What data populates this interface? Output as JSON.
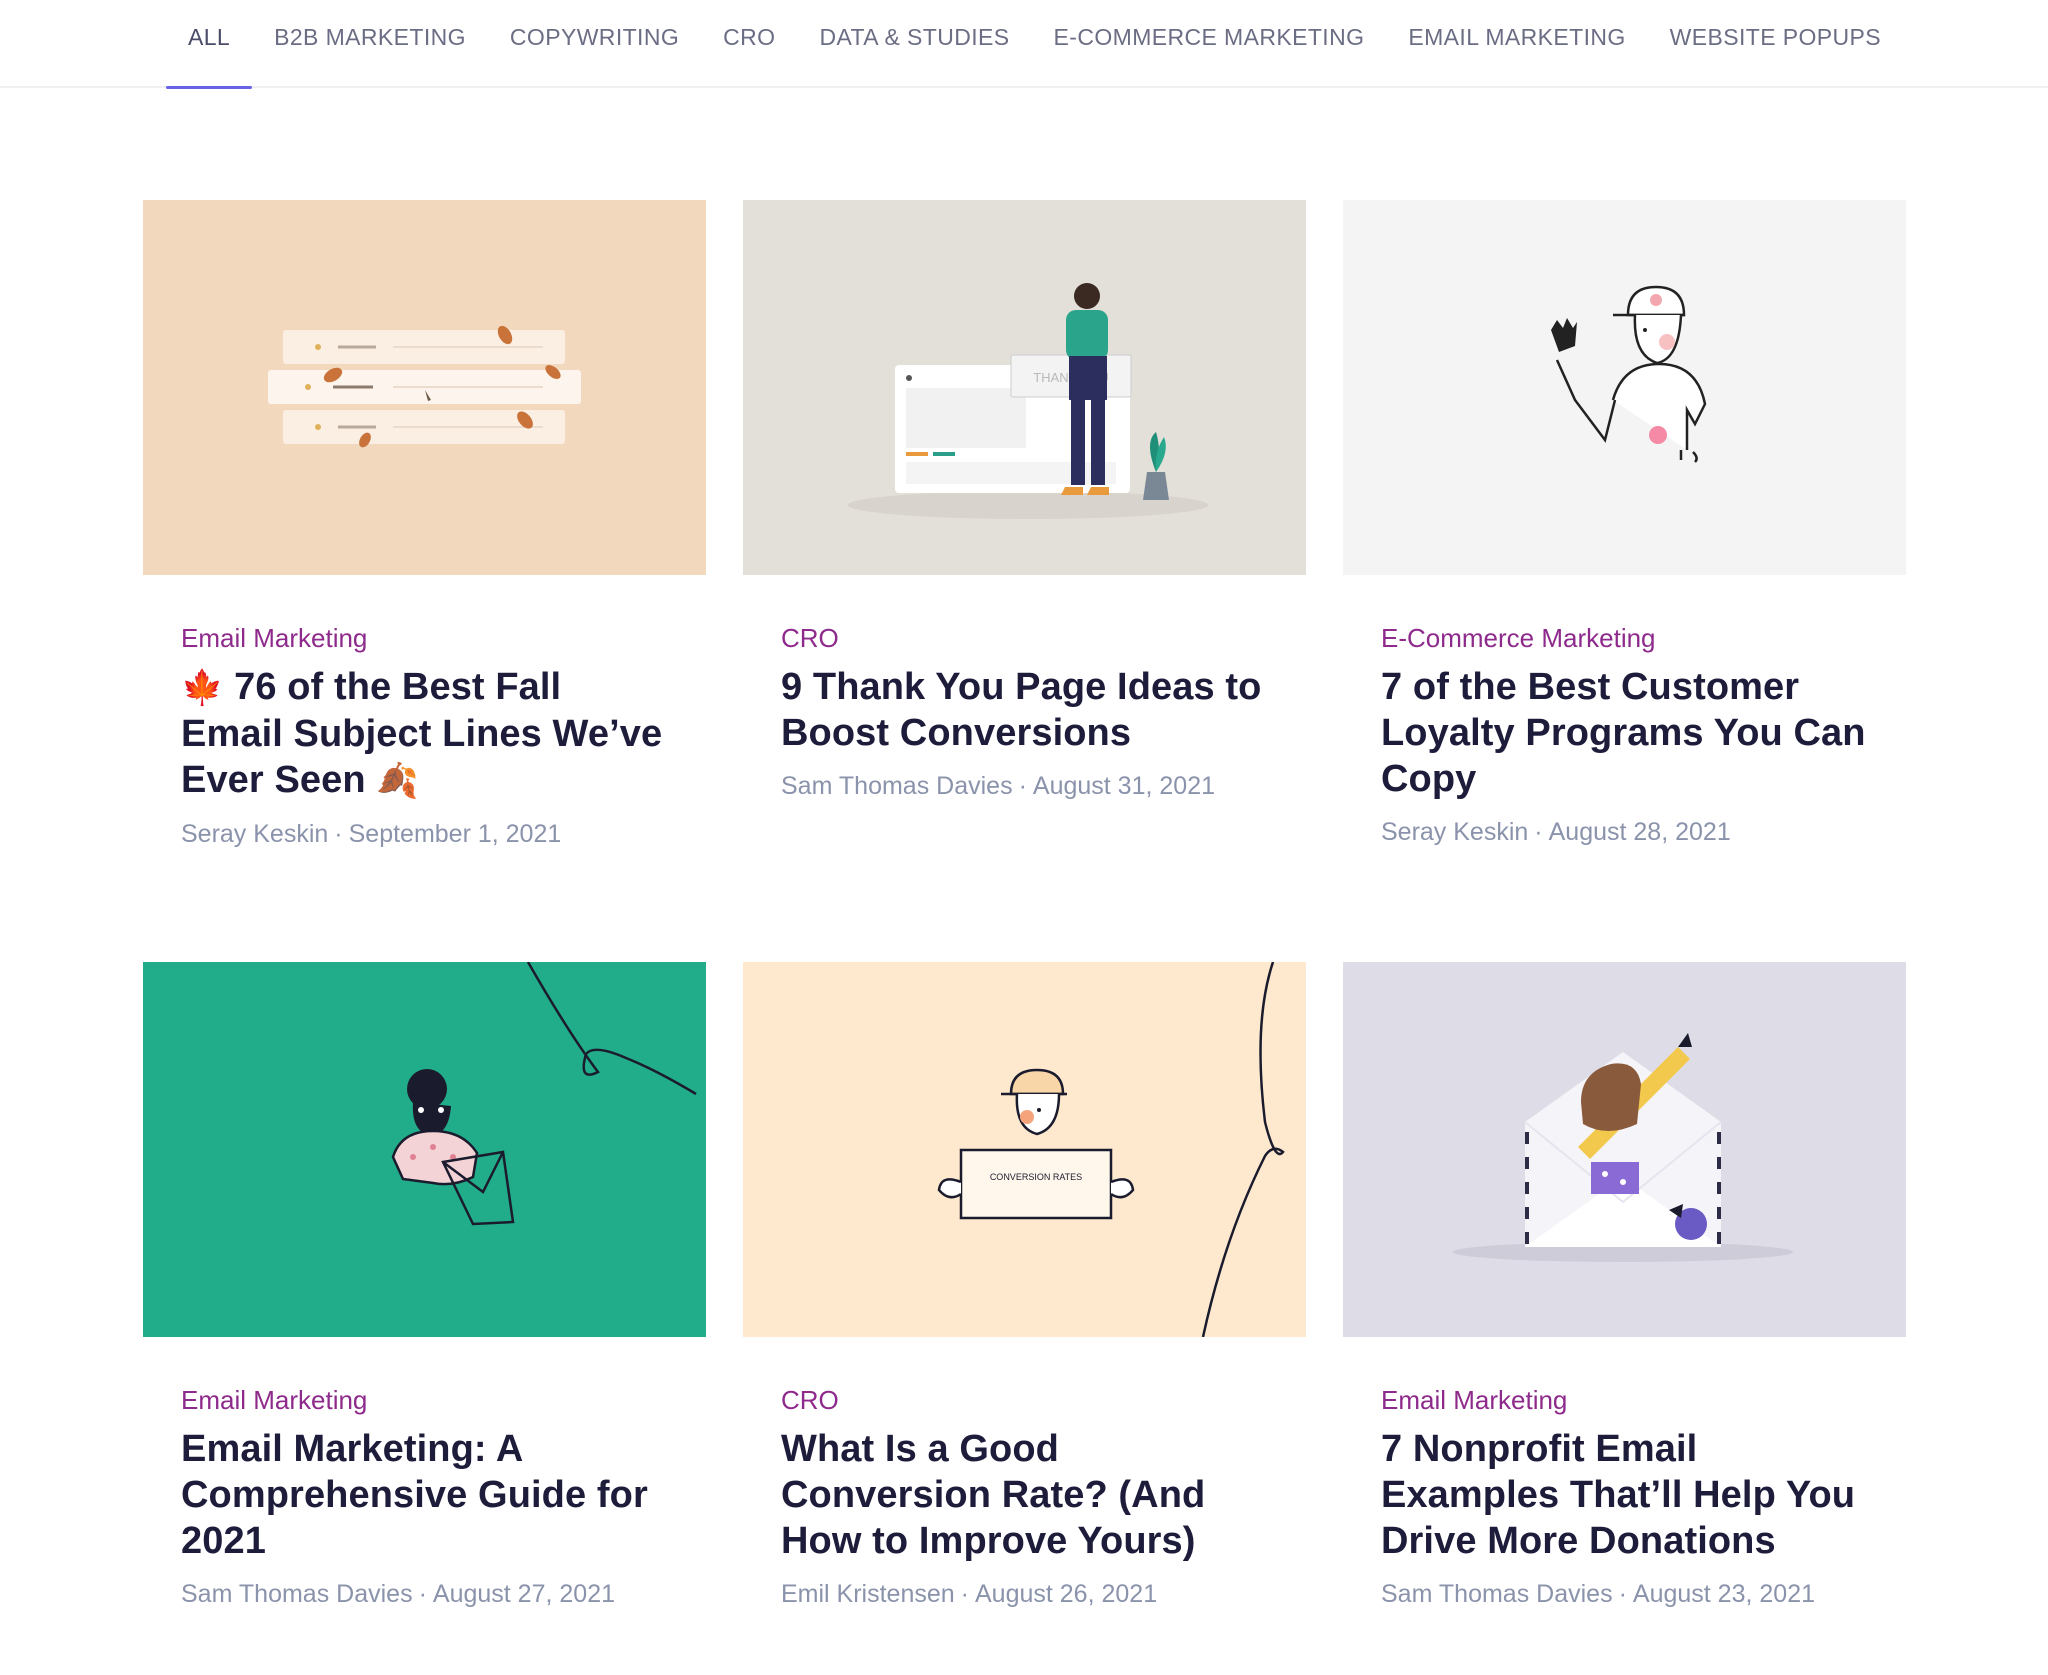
{
  "nav": {
    "items": [
      {
        "label": "ALL",
        "active": true
      },
      {
        "label": "B2B MARKETING"
      },
      {
        "label": "COPYWRITING"
      },
      {
        "label": "CRO"
      },
      {
        "label": "DATA & STUDIES"
      },
      {
        "label": "E-COMMERCE MARKETING"
      },
      {
        "label": "EMAIL MARKETING"
      },
      {
        "label": "WEBSITE POPUPS"
      }
    ]
  },
  "colors": {
    "accent": "#6862e7",
    "category": "#8e2a8c",
    "title": "#1d1c3b",
    "meta": "#8a93ab"
  },
  "posts": [
    {
      "category": "Email Marketing",
      "title_prefix": "🍁",
      "title": "76 of the Best Fall Email Subject Lines We’ve Ever Seen",
      "title_suffix": "🍂",
      "author": "Seray Keskin",
      "date": "September 1, 2021",
      "thumb_bg": "#f2d9bd"
    },
    {
      "category": "CRO",
      "title": "9 Thank You Page Ideas to Boost Conversions",
      "author": "Sam Thomas Davies",
      "date": "August 31, 2021",
      "thumb_bg": "#e3dfd9",
      "image_text": "THANK YOU"
    },
    {
      "category": "E-Commerce Marketing",
      "title": "7 of the Best Customer Loyalty Programs You Can Copy",
      "author": "Seray Keskin",
      "date": "August 28, 2021",
      "thumb_bg": "#f4f4f4"
    },
    {
      "category": "Email Marketing",
      "title": "Email Marketing: A Comprehensive Guide for 2021",
      "author": "Sam Thomas Davies",
      "date": "August 27, 2021",
      "thumb_bg": "#22ad8a"
    },
    {
      "category": "CRO",
      "title": "What Is a Good Conversion Rate? (And How to Improve Yours)",
      "author": "Emil Kristensen",
      "date": "August 26, 2021",
      "thumb_bg": "#fee9cf",
      "image_text": "CONVERSION RATES"
    },
    {
      "category": "Email Marketing",
      "title": "7 Nonprofit Email Examples That’ll Help You Drive More Donations",
      "author": "Sam Thomas Davies",
      "date": "August 23, 2021",
      "thumb_bg": "#dedce6"
    }
  ]
}
